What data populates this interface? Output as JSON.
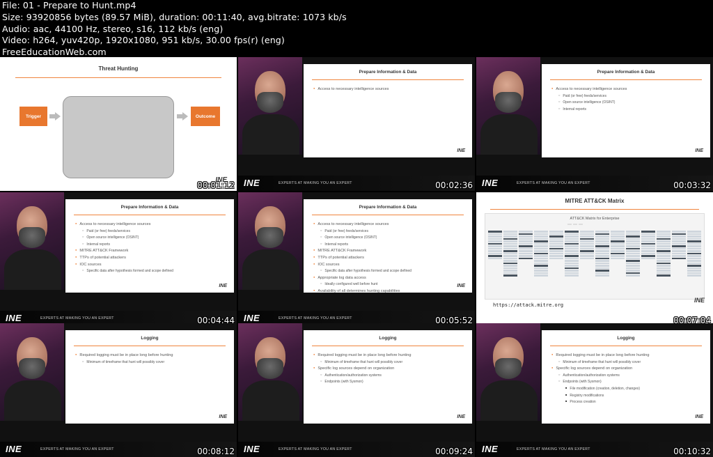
{
  "header": {
    "file": "File: 01 - Prepare to Hunt.mp4",
    "size": "Size: 93920856 bytes (89.57 MiB), duration: 00:11:40, avg.bitrate: 1073 kb/s",
    "audio": "Audio: aac, 44100 Hz, stereo, s16, 112 kb/s (eng)",
    "video": "Video: h264, yuv420p, 1920x1080, 951 kb/s, 30.00 fps(r) (eng)",
    "site": "FreeEducationWeb.com"
  },
  "brand": {
    "logo": "INE",
    "tagline": "EXPERTS AT MAKING YOU AN EXPERT",
    "accent": "#e8772e"
  },
  "thumbs": [
    {
      "timestamp": "00:01:12",
      "title": "Threat Hunting",
      "trigger": "Trigger",
      "outcome": "Outcome"
    },
    {
      "timestamp": "00:02:36",
      "title": "Prepare Information & Data",
      "items": [
        {
          "lvl": 1,
          "text": "Access to necessary intelligence sources"
        }
      ]
    },
    {
      "timestamp": "00:03:32",
      "title": "Prepare Information & Data",
      "items": [
        {
          "lvl": 1,
          "text": "Access to necessary intelligence sources"
        },
        {
          "lvl": 2,
          "text": "Paid (or free) feeds/services"
        },
        {
          "lvl": 2,
          "text": "Open source intelligence (OSINT)"
        },
        {
          "lvl": 2,
          "text": "Internal reports"
        }
      ]
    },
    {
      "timestamp": "00:04:44",
      "title": "Prepare Information & Data",
      "items": [
        {
          "lvl": 1,
          "text": "Access to necessary intelligence sources"
        },
        {
          "lvl": 2,
          "text": "Paid (or free) feeds/services"
        },
        {
          "lvl": 2,
          "text": "Open source intelligence (OSINT)"
        },
        {
          "lvl": 2,
          "text": "Internal reports"
        },
        {
          "lvl": 1,
          "text": "MITRE ATT&CK Framework"
        },
        {
          "lvl": 1,
          "text": "TTPs of potential attackers"
        },
        {
          "lvl": 1,
          "text": "IOC sources"
        },
        {
          "lvl": 2,
          "text": "Specific data after hypothesis formed and scope defined"
        }
      ]
    },
    {
      "timestamp": "00:05:52",
      "title": "Prepare Information & Data",
      "items": [
        {
          "lvl": 1,
          "text": "Access to necessary intelligence sources"
        },
        {
          "lvl": 2,
          "text": "Paid (or free) feeds/services"
        },
        {
          "lvl": 2,
          "text": "Open source intelligence (OSINT)"
        },
        {
          "lvl": 2,
          "text": "Internal reports"
        },
        {
          "lvl": 1,
          "text": "MITRE ATT&CK Framework"
        },
        {
          "lvl": 1,
          "text": "TTPs of potential attackers"
        },
        {
          "lvl": 1,
          "text": "IOC sources"
        },
        {
          "lvl": 2,
          "text": "Specific data after hypothesis formed and scope defined"
        },
        {
          "lvl": 1,
          "text": "Appropriate log data access"
        },
        {
          "lvl": 2,
          "text": "Ideally configured well before hunt"
        },
        {
          "lvl": 1,
          "text": "Availability of all determines hunting capabilities"
        }
      ]
    },
    {
      "timestamp": "00:07:04",
      "title": "MITRE ATT&CK Matrix",
      "matrix_title": "ATT&CK Matrix for Enterprise",
      "url": "https://attack.mitre.org"
    },
    {
      "timestamp": "00:08:12",
      "title": "Logging",
      "items": [
        {
          "lvl": 1,
          "text": "Required logging must be in place long before hunting"
        },
        {
          "lvl": 2,
          "text": "Minimum of timeframe that hunt will possibly cover"
        }
      ]
    },
    {
      "timestamp": "00:09:24",
      "title": "Logging",
      "items": [
        {
          "lvl": 1,
          "text": "Required logging must be in place long before hunting"
        },
        {
          "lvl": 2,
          "text": "Minimum of timeframe that hunt will possibly cover"
        },
        {
          "lvl": 1,
          "text": "Specific log sources depend on organization"
        },
        {
          "lvl": 2,
          "text": "Authentication/authorization systems"
        },
        {
          "lvl": 2,
          "text": "Endpoints (with Sysmon)"
        }
      ]
    },
    {
      "timestamp": "00:10:32",
      "title": "Logging",
      "items": [
        {
          "lvl": 1,
          "text": "Required logging must be in place long before hunting"
        },
        {
          "lvl": 2,
          "text": "Minimum of timeframe that hunt will possibly cover"
        },
        {
          "lvl": 1,
          "text": "Specific log sources depend on organization"
        },
        {
          "lvl": 2,
          "text": "Authentication/authorization systems"
        },
        {
          "lvl": 2,
          "text": "Endpoints (with Sysmon)"
        },
        {
          "lvl": 3,
          "text": "File modification (creation, deletion, changes)"
        },
        {
          "lvl": 3,
          "text": "Registry modifications"
        },
        {
          "lvl": 3,
          "text": "Process creation"
        }
      ]
    }
  ]
}
